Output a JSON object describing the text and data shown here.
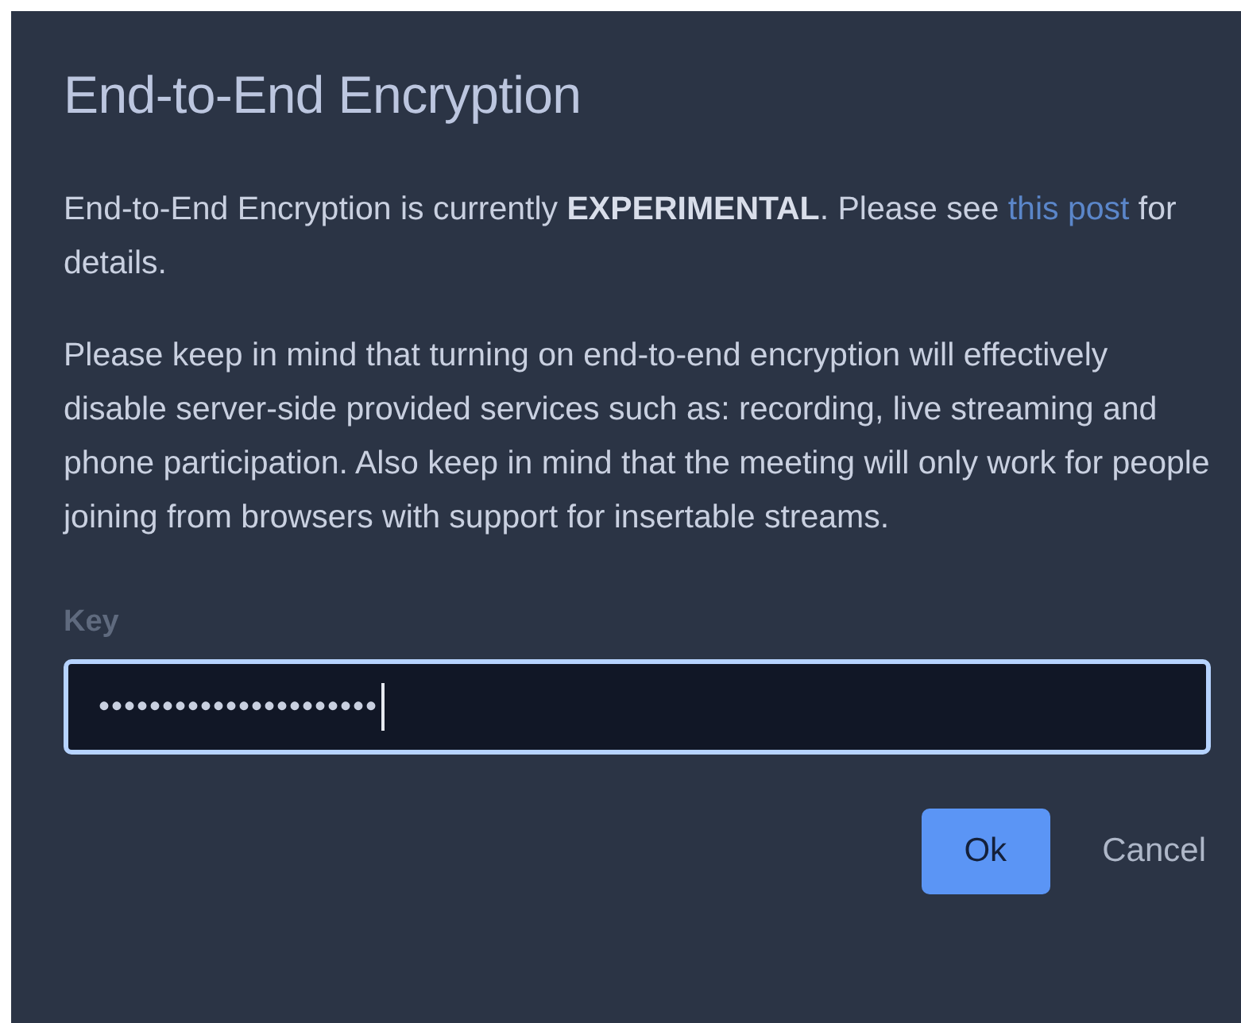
{
  "dialog": {
    "title": "End-to-End Encryption",
    "paragraphs": [
      {
        "text": "End-to-End Encryption is currently **EXPERIMENTAL**. Please see ",
        "link": "this post",
        "after": " for details."
      },
      {
        "text": "Please keep in mind that turning on end-to-end encryption will effectively disable server-side provided services such as: recording, live streaming and phone participation. Also keep in mind that the meeting will only work for people joining from browsers with support for insertable streams."
      }
    ],
    "key_field": {
      "label": "Key",
      "value": "••••••••••••••••••••••",
      "focused": true
    },
    "buttons": [
      {
        "label": "Ok",
        "kind": "primary"
      },
      {
        "label": "Cancel",
        "kind": "secondary"
      }
    ]
  }
}
